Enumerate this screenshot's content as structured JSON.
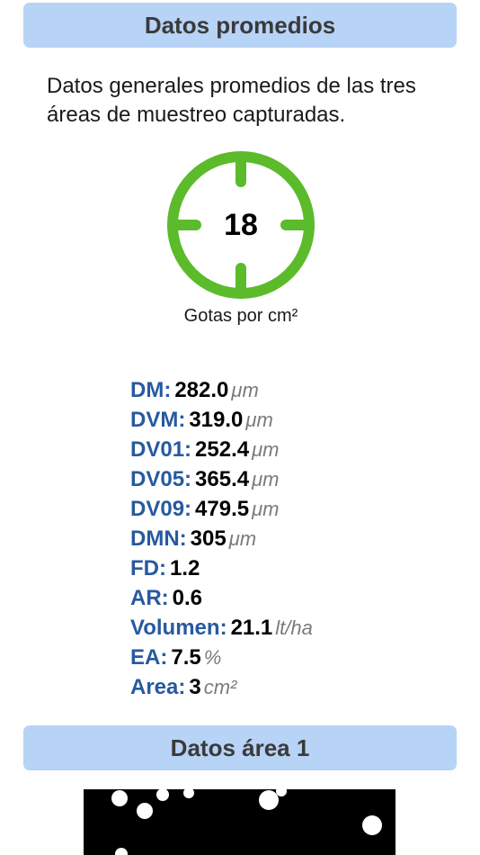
{
  "header_promedios": "Datos promedios",
  "intro_text": "Datos generales promedios de las tres áreas de muestreo capturadas.",
  "gauge": {
    "value": "18",
    "caption": "Gotas por cm²",
    "color": "#5bbb2b"
  },
  "stats": [
    {
      "label": "DM:",
      "value": "282.0",
      "unit": "μm"
    },
    {
      "label": "DVM:",
      "value": "319.0",
      "unit": "μm"
    },
    {
      "label": "DV01:",
      "value": "252.4",
      "unit": "μm"
    },
    {
      "label": "DV05:",
      "value": "365.4",
      "unit": "μm"
    },
    {
      "label": "DV09:",
      "value": "479.5",
      "unit": "μm"
    },
    {
      "label": "DMN:",
      "value": "305",
      "unit": "μm"
    },
    {
      "label": "FD:",
      "value": "1.2",
      "unit": ""
    },
    {
      "label": "AR:",
      "value": "0.6",
      "unit": ""
    },
    {
      "label": "Volumen:",
      "value": "21.1",
      "unit": "lt/ha"
    },
    {
      "label": "EA:",
      "value": "7.5",
      "unit": "%"
    },
    {
      "label": "Area:",
      "value": "3",
      "unit": "cm²"
    }
  ],
  "header_area1": "Datos área 1",
  "colors": {
    "header_bg": "#b7d3f6",
    "label_blue": "#275a9e"
  }
}
